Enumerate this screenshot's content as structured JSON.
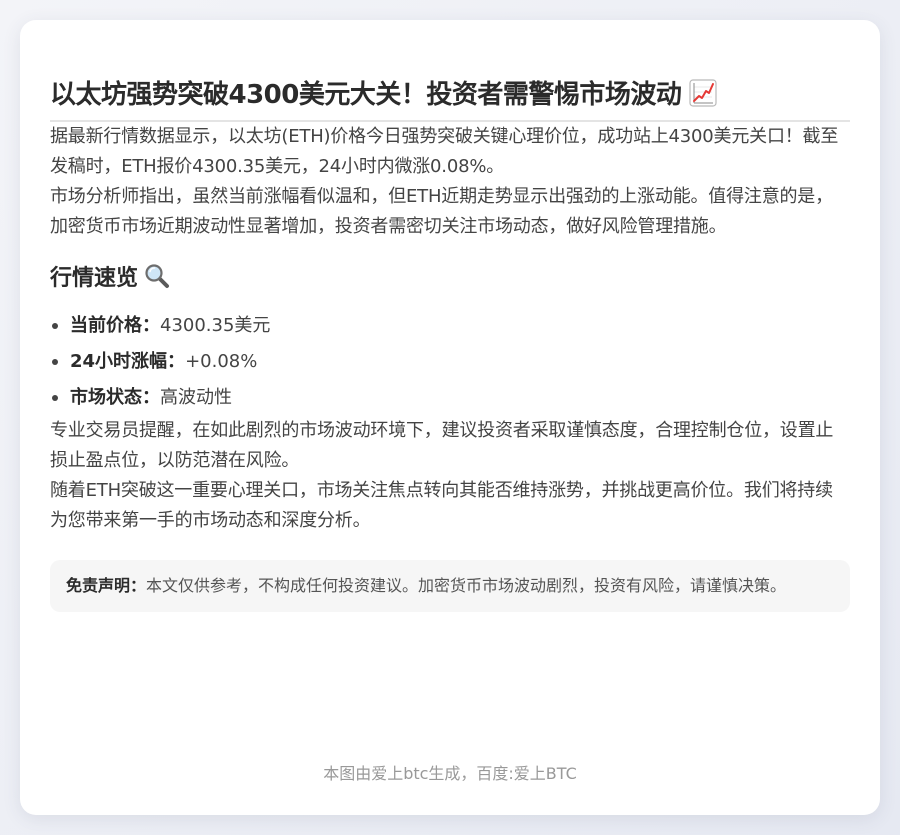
{
  "article": {
    "title": "以太坊强势突破4300美元大关！投资者需警惕市场波动",
    "title_icon": "chart-increasing-icon",
    "intro_paragraph": "据最新行情数据显示，以太坊(ETH)价格今日强势突破关键心理价位，成功站上4300美元关口！截至发稿时，ETH报价4300.35美元，24小时内微涨0.08%。",
    "analysis_paragraph": "市场分析师指出，虽然当前涨幅看似温和，但ETH近期走势显示出强劲的上涨动能。值得注意的是，加密货币市场近期波动性显著增加，投资者需密切关注市场动态，做好风险管理措施。",
    "overview": {
      "heading": "行情速览",
      "heading_icon": "magnifying-glass-icon",
      "items": [
        {
          "label": "当前价格：",
          "value": "4300.35美元"
        },
        {
          "label": "24小时涨幅：",
          "value": "+0.08%"
        },
        {
          "label": "市场状态：",
          "value": "高波动性"
        }
      ]
    },
    "advice_paragraph": "专业交易员提醒，在如此剧烈的市场波动环境下，建议投资者采取谨慎态度，合理控制仓位，设置止损止盈点位，以防范潜在风险。",
    "outlook_paragraph": "随着ETH突破这一重要心理关口，市场关注焦点转向其能否维持涨势，并挑战更高价位。我们将持续为您带来第一手的市场动态和深度分析。",
    "disclaimer": {
      "label": "免责声明：",
      "text": "本文仅供参考，不构成任何投资建议。加密货币市场波动剧烈，投资有风险，请谨慎决策。"
    },
    "footer": "本图由爱上btc生成，百度:爱上BTC"
  },
  "colors": {
    "background": "#eef0f5",
    "card": "#ffffff",
    "title_text": "#2b2b2b",
    "body_text": "#444444",
    "footer_text": "#999999",
    "disclaimer_bg": "#f6f6f6",
    "chart_icon_line": "#e53935"
  }
}
